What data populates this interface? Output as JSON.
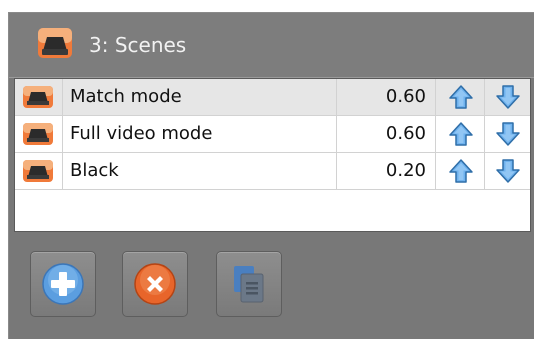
{
  "panel": {
    "title": "3: Scenes",
    "title_icon": "scene-icon"
  },
  "scenes": [
    {
      "name": "Match mode",
      "value": "0.60",
      "icon": "scene-icon",
      "selected": true
    },
    {
      "name": "Full video mode",
      "value": "0.60",
      "icon": "scene-icon",
      "selected": false
    },
    {
      "name": "Black",
      "value": "0.20",
      "icon": "scene-icon",
      "selected": false
    }
  ],
  "toolbar": {
    "add_icon": "plus-icon",
    "remove_icon": "close-icon",
    "copy_icon": "copy-icon"
  },
  "colors": {
    "frame": "#787878",
    "selected_row": "#e6e6e6",
    "arrow_blue": "#5aa0e0",
    "add_blue": "#5b9ee0",
    "remove_orange": "#e8652a"
  }
}
